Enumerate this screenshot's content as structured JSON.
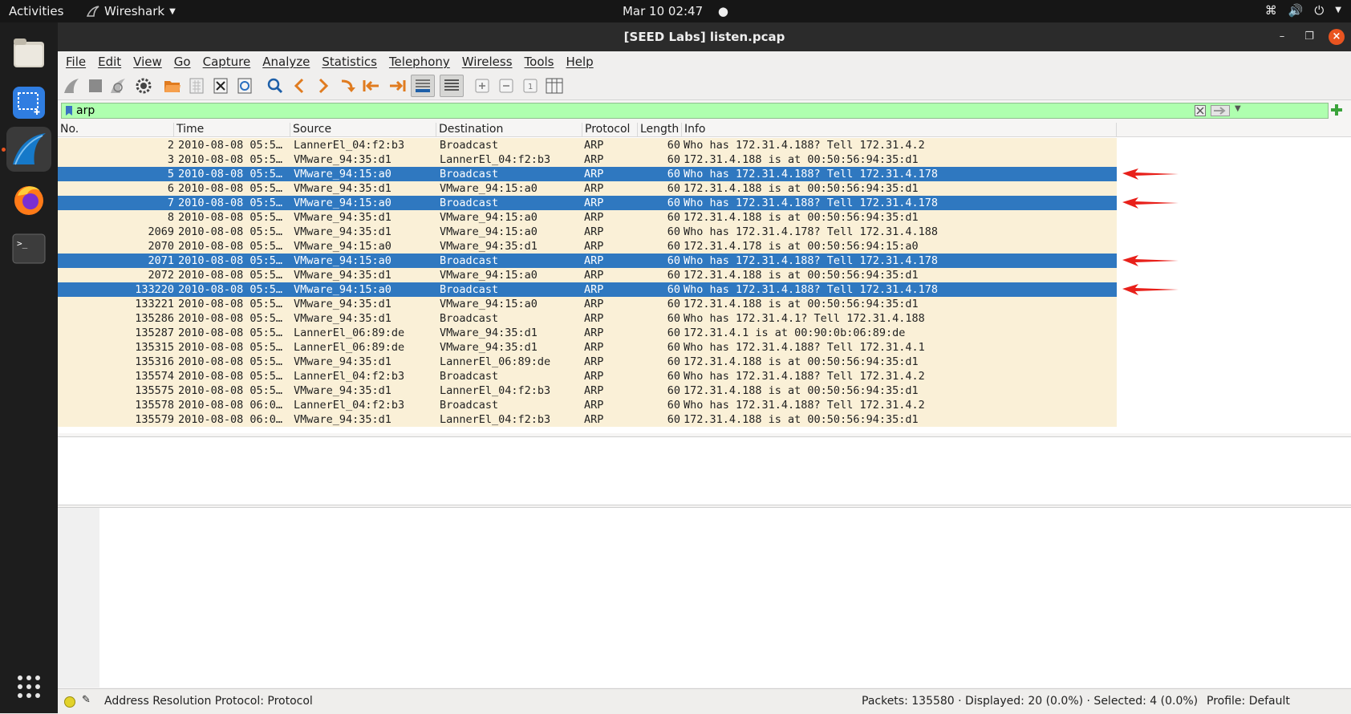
{
  "topbar": {
    "activities": "Activities",
    "app_name": "Wireshark",
    "clock": "Mar 10  02:47"
  },
  "window": {
    "title": "[SEED Labs] listen.pcap",
    "menu": [
      "File",
      "Edit",
      "View",
      "Go",
      "Capture",
      "Analyze",
      "Statistics",
      "Telephony",
      "Wireless",
      "Tools",
      "Help"
    ]
  },
  "filter": {
    "value": "arp"
  },
  "columns": [
    "No.",
    "Time",
    "Source",
    "Destination",
    "Protocol",
    "Length",
    "Info"
  ],
  "packets": [
    {
      "no": "2",
      "time": "2010-08-08 05:5…",
      "src": "LannerEl_04:f2:b3",
      "dst": "Broadcast",
      "proto": "ARP",
      "len": "60",
      "info": "Who has 172.31.4.188? Tell 172.31.4.2",
      "selected": false
    },
    {
      "no": "3",
      "time": "2010-08-08 05:5…",
      "src": "VMware_94:35:d1",
      "dst": "LannerEl_04:f2:b3",
      "proto": "ARP",
      "len": "60",
      "info": "172.31.4.188 is at 00:50:56:94:35:d1",
      "selected": false
    },
    {
      "no": "5",
      "time": "2010-08-08 05:5…",
      "src": "VMware_94:15:a0",
      "dst": "Broadcast",
      "proto": "ARP",
      "len": "60",
      "info": "Who has 172.31.4.188? Tell 172.31.4.178",
      "selected": true
    },
    {
      "no": "6",
      "time": "2010-08-08 05:5…",
      "src": "VMware_94:35:d1",
      "dst": "VMware_94:15:a0",
      "proto": "ARP",
      "len": "60",
      "info": "172.31.4.188 is at 00:50:56:94:35:d1",
      "selected": false
    },
    {
      "no": "7",
      "time": "2010-08-08 05:5…",
      "src": "VMware_94:15:a0",
      "dst": "Broadcast",
      "proto": "ARP",
      "len": "60",
      "info": "Who has 172.31.4.188? Tell 172.31.4.178",
      "selected": true
    },
    {
      "no": "8",
      "time": "2010-08-08 05:5…",
      "src": "VMware_94:35:d1",
      "dst": "VMware_94:15:a0",
      "proto": "ARP",
      "len": "60",
      "info": "172.31.4.188 is at 00:50:56:94:35:d1",
      "selected": false
    },
    {
      "no": "2069",
      "time": "2010-08-08 05:5…",
      "src": "VMware_94:35:d1",
      "dst": "VMware_94:15:a0",
      "proto": "ARP",
      "len": "60",
      "info": "Who has 172.31.4.178? Tell 172.31.4.188",
      "selected": false
    },
    {
      "no": "2070",
      "time": "2010-08-08 05:5…",
      "src": "VMware_94:15:a0",
      "dst": "VMware_94:35:d1",
      "proto": "ARP",
      "len": "60",
      "info": "172.31.4.178 is at 00:50:56:94:15:a0",
      "selected": false
    },
    {
      "no": "2071",
      "time": "2010-08-08 05:5…",
      "src": "VMware_94:15:a0",
      "dst": "Broadcast",
      "proto": "ARP",
      "len": "60",
      "info": "Who has 172.31.4.188? Tell 172.31.4.178",
      "selected": true
    },
    {
      "no": "2072",
      "time": "2010-08-08 05:5…",
      "src": "VMware_94:35:d1",
      "dst": "VMware_94:15:a0",
      "proto": "ARP",
      "len": "60",
      "info": "172.31.4.188 is at 00:50:56:94:35:d1",
      "selected": false
    },
    {
      "no": "133220",
      "time": "2010-08-08 05:5…",
      "src": "VMware_94:15:a0",
      "dst": "Broadcast",
      "proto": "ARP",
      "len": "60",
      "info": "Who has 172.31.4.188? Tell 172.31.4.178",
      "selected": true
    },
    {
      "no": "133221",
      "time": "2010-08-08 05:5…",
      "src": "VMware_94:35:d1",
      "dst": "VMware_94:15:a0",
      "proto": "ARP",
      "len": "60",
      "info": "172.31.4.188 is at 00:50:56:94:35:d1",
      "selected": false
    },
    {
      "no": "135286",
      "time": "2010-08-08 05:5…",
      "src": "VMware_94:35:d1",
      "dst": "Broadcast",
      "proto": "ARP",
      "len": "60",
      "info": "Who has 172.31.4.1? Tell 172.31.4.188",
      "selected": false
    },
    {
      "no": "135287",
      "time": "2010-08-08 05:5…",
      "src": "LannerEl_06:89:de",
      "dst": "VMware_94:35:d1",
      "proto": "ARP",
      "len": "60",
      "info": "172.31.4.1 is at 00:90:0b:06:89:de",
      "selected": false
    },
    {
      "no": "135315",
      "time": "2010-08-08 05:5…",
      "src": "LannerEl_06:89:de",
      "dst": "VMware_94:35:d1",
      "proto": "ARP",
      "len": "60",
      "info": "Who has 172.31.4.188? Tell 172.31.4.1",
      "selected": false
    },
    {
      "no": "135316",
      "time": "2010-08-08 05:5…",
      "src": "VMware_94:35:d1",
      "dst": "LannerEl_06:89:de",
      "proto": "ARP",
      "len": "60",
      "info": "172.31.4.188 is at 00:50:56:94:35:d1",
      "selected": false
    },
    {
      "no": "135574",
      "time": "2010-08-08 05:5…",
      "src": "LannerEl_04:f2:b3",
      "dst": "Broadcast",
      "proto": "ARP",
      "len": "60",
      "info": "Who has 172.31.4.188? Tell 172.31.4.2",
      "selected": false
    },
    {
      "no": "135575",
      "time": "2010-08-08 05:5…",
      "src": "VMware_94:35:d1",
      "dst": "LannerEl_04:f2:b3",
      "proto": "ARP",
      "len": "60",
      "info": "172.31.4.188 is at 00:50:56:94:35:d1",
      "selected": false
    },
    {
      "no": "135578",
      "time": "2010-08-08 06:0…",
      "src": "LannerEl_04:f2:b3",
      "dst": "Broadcast",
      "proto": "ARP",
      "len": "60",
      "info": "Who has 172.31.4.188? Tell 172.31.4.2",
      "selected": false
    },
    {
      "no": "135579",
      "time": "2010-08-08 06:0…",
      "src": "VMware_94:35:d1",
      "dst": "LannerEl_04:f2:b3",
      "proto": "ARP",
      "len": "60",
      "info": "172.31.4.188 is at 00:50:56:94:35:d1",
      "selected": false
    }
  ],
  "statusbar": {
    "message": "Address Resolution Protocol: Protocol",
    "counts": "Packets: 135580 · Displayed: 20 (0.0%) · Selected: 4 (0.0%)",
    "profile": "Profile: Default"
  },
  "colors": {
    "selected_row": "#2f78c0",
    "row_bg": "#faf0d7",
    "filter_bg": "#afffaf",
    "annotation_arrow": "#e8201a"
  }
}
